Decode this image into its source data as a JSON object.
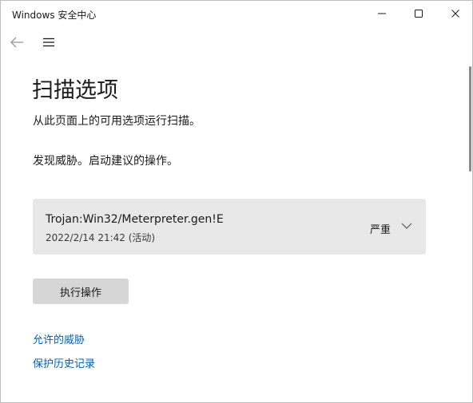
{
  "window": {
    "title": "Windows 安全中心"
  },
  "titlebar": {
    "icons": [
      "minimize-icon",
      "maximize-icon",
      "close-icon"
    ]
  },
  "nav": {
    "icons": [
      "back-arrow-icon",
      "hamburger-menu-icon"
    ]
  },
  "page": {
    "title": "扫描选项",
    "subtitle": "从此页面上的可用选项运行扫描。",
    "found_text": "发现威胁。启动建议的操作。"
  },
  "threat": {
    "name": "Trojan:Win32/Meterpreter.gen!E",
    "date": "2022/2/14 21:42 (活动)",
    "severity": "严重"
  },
  "actions": {
    "execute_label": "执行操作"
  },
  "links": {
    "allowed_threats": "允许的威胁",
    "protection_history": "保护历史记录"
  },
  "colors": {
    "link": "#005fb8",
    "card_bg": "#e8e8e8",
    "button_bg": "#d6d6d6"
  }
}
